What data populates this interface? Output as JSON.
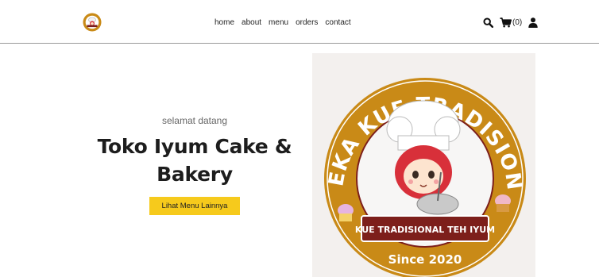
{
  "brand": {
    "logo_icon": "bakery-logo-icon",
    "accent_color": "#f6ca1c"
  },
  "nav": {
    "links": [
      "home",
      "about",
      "menu",
      "orders",
      "contact"
    ],
    "cart_count": "(0)",
    "icons": [
      "search-icon",
      "cart-icon",
      "user-icon"
    ]
  },
  "hero": {
    "greeting": "selamat datang",
    "title": "Toko Iyum Cake & Bakery",
    "cta_label": "Lihat Menu Lainnya",
    "image": {
      "arc_text": "ANEKA KUE TRADISIONAL",
      "ribbon_text": "KUE TRADISIONAL TEH IYUM",
      "since_text": "Since 2020"
    }
  }
}
